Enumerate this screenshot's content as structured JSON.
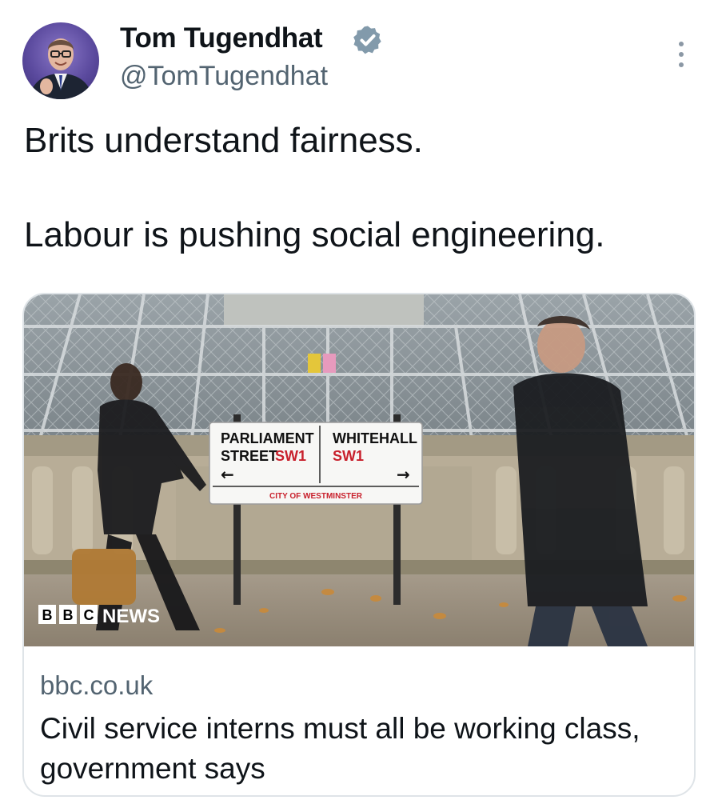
{
  "author": {
    "name": "Tom Tugendhat",
    "handle": "@TomTugendhat",
    "verified": true
  },
  "tweet": {
    "lines": [
      "Brits understand fairness.",
      "Labour is pushing social engineering."
    ]
  },
  "link_card": {
    "image_alt": "People walking past Parliament Street / Whitehall street sign",
    "sign": {
      "left_line1": "PARLIAMENT",
      "left_line2": "STREET",
      "left_code": "SW1",
      "right_line1": "WHITEHALL",
      "right_code": "SW1",
      "footer": "CITY OF WESTMINSTER",
      "left_arrow": "←",
      "right_arrow": "→"
    },
    "watermark": {
      "blocks": [
        "B",
        "B",
        "C"
      ],
      "word": "NEWS"
    },
    "domain": "bbc.co.uk",
    "title": "Civil service interns must all be working class, government says"
  },
  "colors": {
    "text": "#0f1419",
    "secondary": "#536471",
    "verified_badge": "#829aab",
    "card_border": "#dfe4e8"
  },
  "icons": {
    "verified": "verified-badge-icon",
    "more": "more-vertical-icon"
  }
}
